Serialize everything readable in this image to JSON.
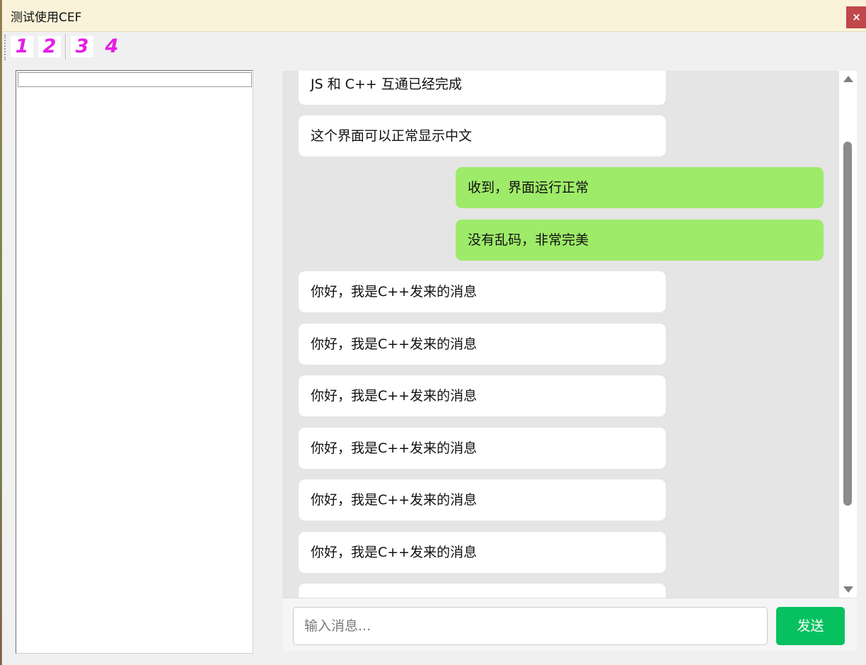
{
  "window": {
    "title": "测试使用CEF",
    "close_label": "×"
  },
  "toolbar": {
    "buttons": [
      {
        "label": "1"
      },
      {
        "label": "2"
      },
      {
        "label": "3"
      },
      {
        "label": "4"
      }
    ],
    "label_color": "#e51ee6"
  },
  "chat": {
    "messages": [
      {
        "side": "left",
        "text": "JS 和 C++ 互通已经完成"
      },
      {
        "side": "left",
        "text": "这个界面可以正常显示中文"
      },
      {
        "side": "right",
        "text": "收到，界面运行正常"
      },
      {
        "side": "right",
        "text": "没有乱码，非常完美"
      },
      {
        "side": "left",
        "text": "你好，我是C++发来的消息"
      },
      {
        "side": "left",
        "text": "你好，我是C++发来的消息"
      },
      {
        "side": "left",
        "text": "你好，我是C++发来的消息"
      },
      {
        "side": "left",
        "text": "你好，我是C++发来的消息"
      },
      {
        "side": "left",
        "text": "你好，我是C++发来的消息"
      },
      {
        "side": "left",
        "text": "你好，我是C++发来的消息"
      },
      {
        "side": "left",
        "text": ""
      }
    ],
    "incoming_color": "#ffffff",
    "outgoing_color": "#9eeb6a",
    "background_color": "#e5e5e5"
  },
  "composer": {
    "placeholder": "输入消息...",
    "value": "",
    "send_label": "发送",
    "send_color": "#07c160"
  }
}
